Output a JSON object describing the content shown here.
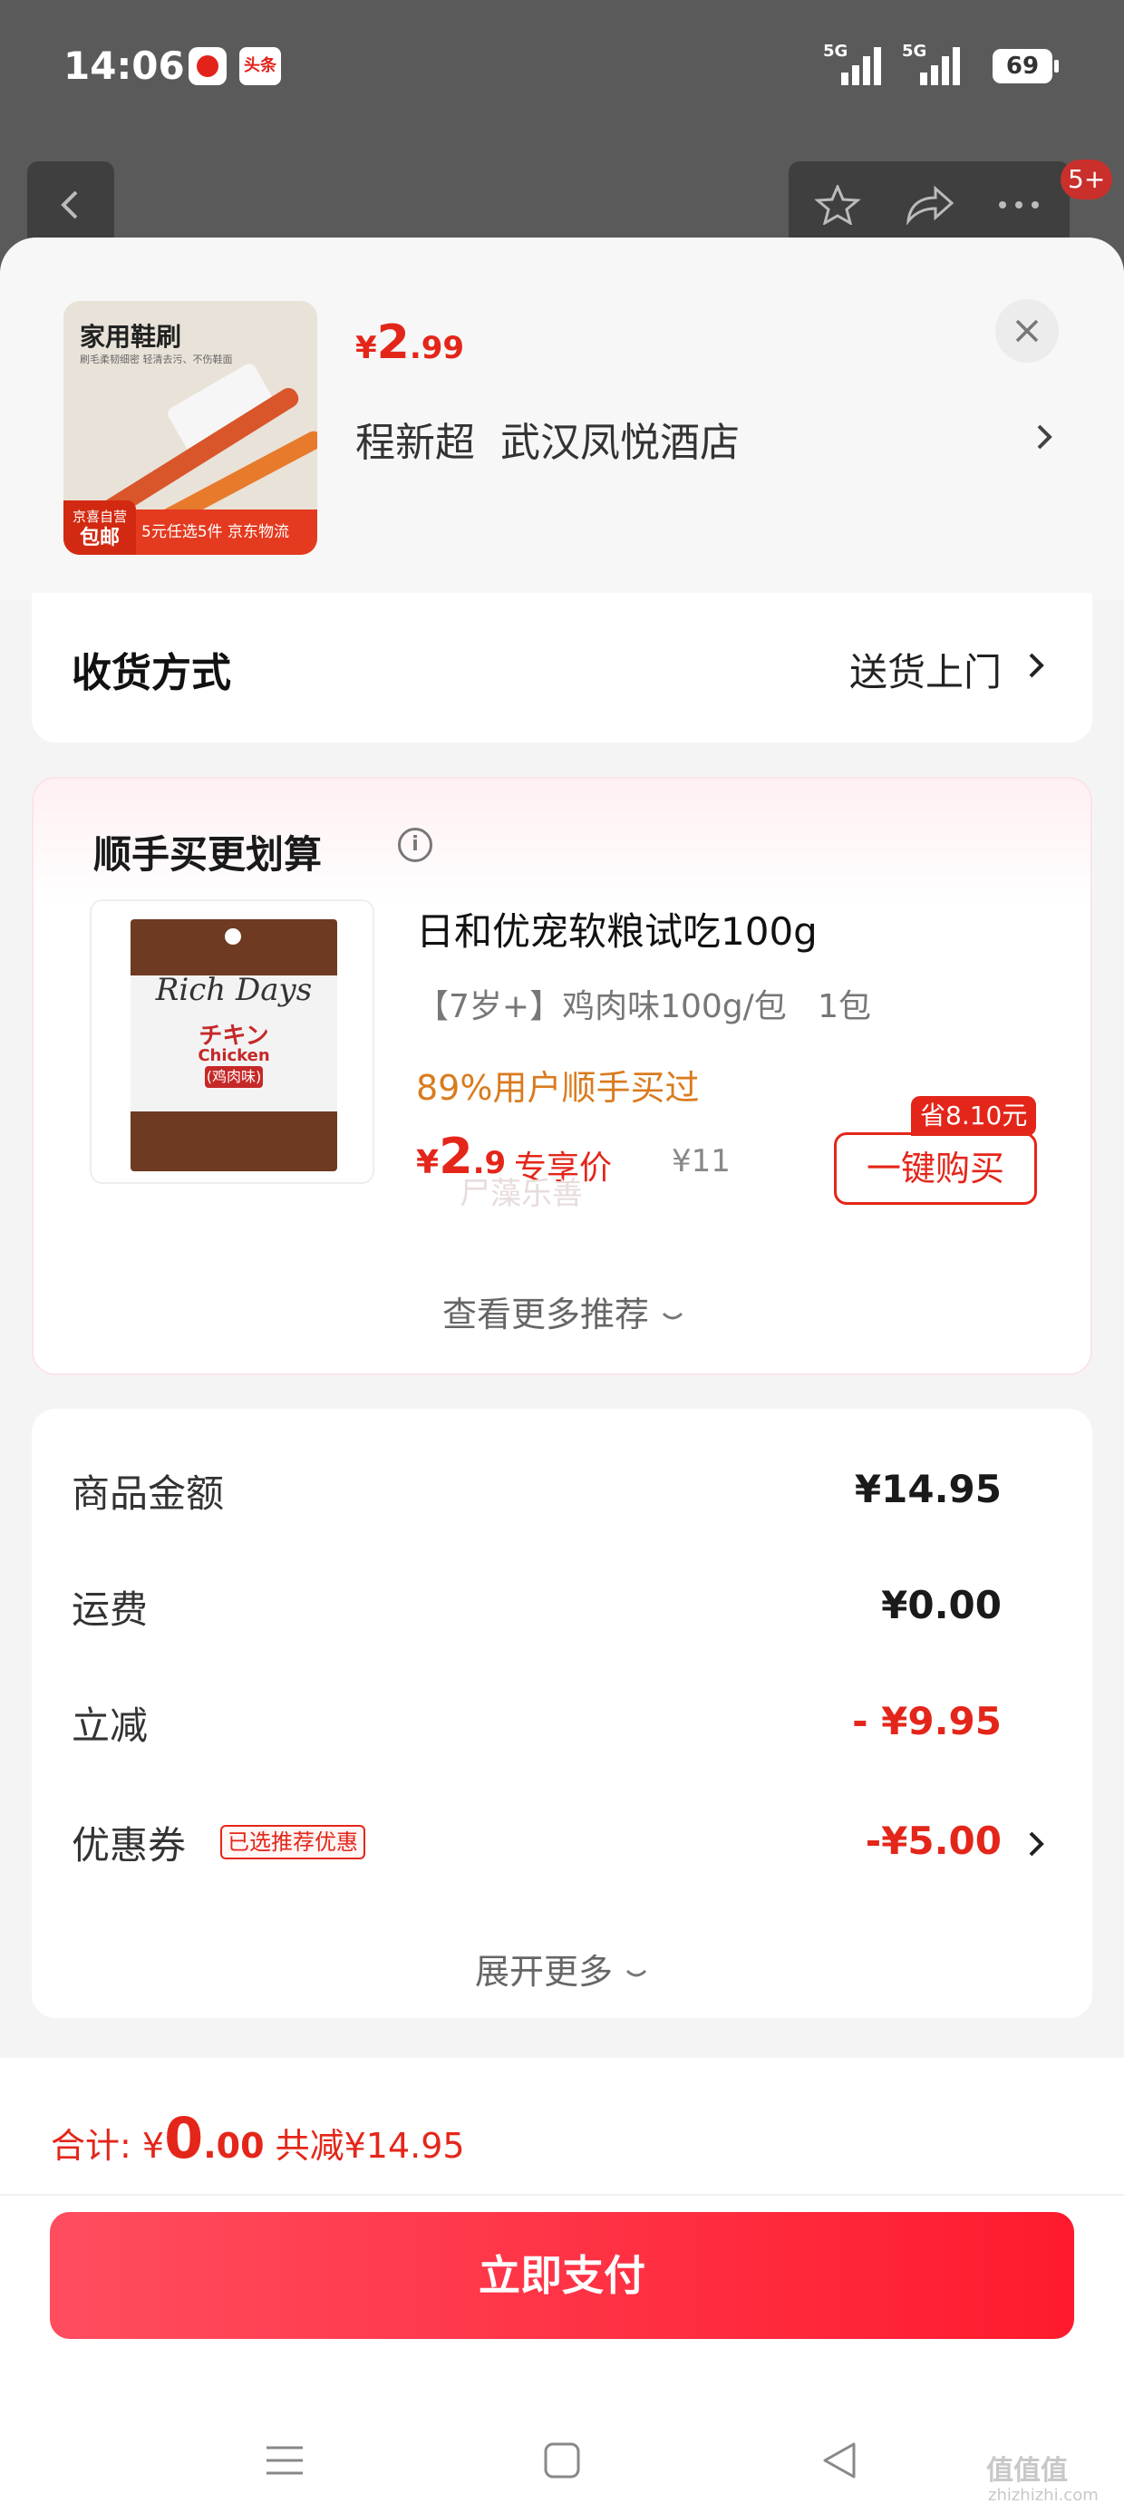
{
  "status_bar": {
    "time": "14:06",
    "app_badge_2": "头条",
    "signal_1_label": "5G",
    "signal_2_label": "5G",
    "battery": "69"
  },
  "nav": {
    "badge": "5+"
  },
  "product": {
    "thumb_title": "家用鞋刷",
    "thumb_sub": "刷毛柔韧细密 轻清去污、不伤鞋面",
    "thumb_tag_top": "京喜自营",
    "thumb_tag_main": "包邮",
    "thumb_bottom": "5元任选5件 京东物流",
    "price_currency": "¥",
    "price_int": "2",
    "price_dec": ".99",
    "address": "程新超  武汉凤悦酒店"
  },
  "delivery": {
    "label": "收货方式",
    "value": "送货上门"
  },
  "upsell": {
    "title": "顺手买更划算",
    "pkg_logo": "Rich Days",
    "pkg_jp": "チキン",
    "pkg_en": "Chicken",
    "pkg_cn": "(鸡肉味)",
    "name": "日和优宠软粮试吃100g",
    "spec": "【7岁+】鸡肉味100g/包   1包",
    "users_pct": "89%用户顺手买过",
    "price_currency": "¥",
    "price_int": "2",
    "price_dec": ".9",
    "exclusive_label": "专享价",
    "original_price": "¥11",
    "watermark": "尸藻乐善",
    "save_badge": "省8.10元",
    "buy_button": "一键购买",
    "more": "查看更多推荐"
  },
  "summary": {
    "rows": [
      {
        "label": "商品金额",
        "value": "¥14.95"
      },
      {
        "label": "运费",
        "value": "¥0.00"
      },
      {
        "label": "立减",
        "value": "- ¥9.95"
      },
      {
        "label": "优惠券",
        "value": "-¥5.00"
      }
    ],
    "coupon_tag": "已选推荐优惠",
    "expand": "展开更多"
  },
  "checkout": {
    "total_label": "合计: ¥",
    "total_int": "0",
    "total_dec": ".00",
    "saved": " 共减¥14.95",
    "pay_button": "立即支付"
  },
  "watermark_site": "值值值",
  "watermark_url": "zhizhizhi.com",
  "colors": {
    "accent_red": "#e4261a",
    "pay_gradient_start": "#ff4d5f",
    "pay_gradient_end": "#ff1a2d",
    "highlight_orange": "#d97b1e"
  }
}
